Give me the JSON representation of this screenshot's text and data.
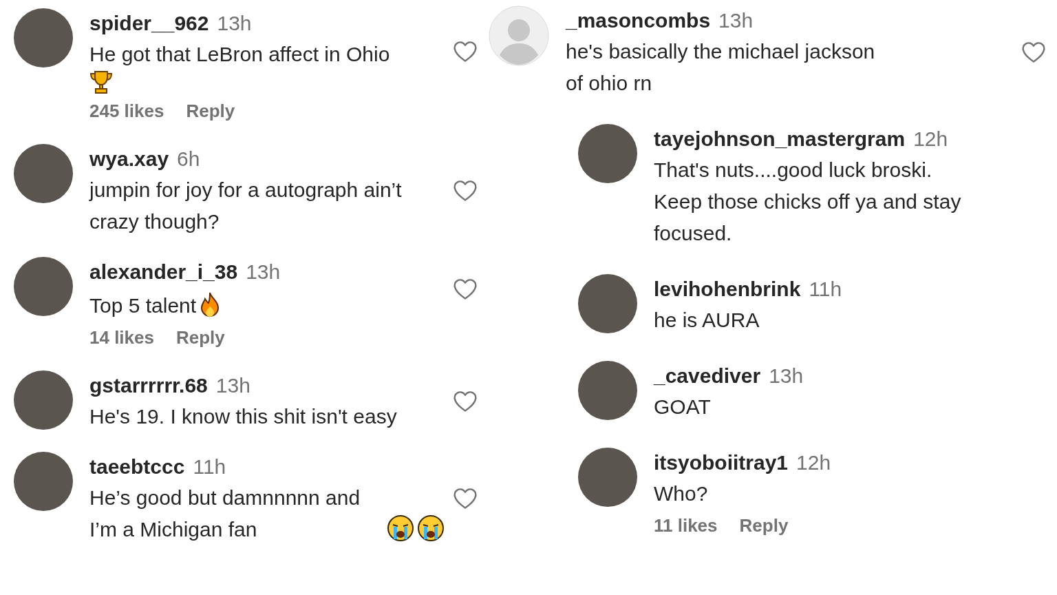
{
  "columns": [
    {
      "comments": [
        {
          "username": "spider__962",
          "time": "13h",
          "text": "He got that LeBron affect in Ohio",
          "emoji_line": [
            {
              "kind": "trophy"
            }
          ],
          "likes": "245 likes",
          "reply": "Reply",
          "liked": false,
          "kind": "photo"
        },
        {
          "username": "wya.xay",
          "time": "6h",
          "text": "jumpin for joy for a autograph ain’t crazy though?",
          "liked": false,
          "kind": "photo"
        },
        {
          "username": "alexander_i_38",
          "time": "13h",
          "text": "Top 5 talent",
          "emojis": [
            {
              "kind": "fire"
            }
          ],
          "likes": "14 likes",
          "reply": "Reply",
          "liked": false,
          "kind": "photo"
        },
        {
          "username": "gstarrrrrr.68",
          "time": "13h",
          "text": "He's 19. I know this shit isn't easy",
          "liked": false,
          "kind": "photo"
        },
        {
          "username": "taeebtccc",
          "time": "11h",
          "text": "He’s good but damnnnnn and I’m a Michigan fan",
          "emojis": [
            {
              "kind": "crying"
            },
            {
              "kind": "crying"
            }
          ],
          "liked": false,
          "kind": "photo"
        }
      ]
    },
    {
      "comments": [
        {
          "username": "_masoncombs",
          "time": "13h",
          "text": "he's basically the michael jackson of ohio rn",
          "liked": false,
          "kind": "default"
        },
        {
          "username": "tayejohnson_mastergram",
          "time": "12h",
          "text": "That's nuts....good luck broski. Keep those chicks off ya and stay focused.",
          "kind": "photo"
        },
        {
          "username": "levihohenbrink",
          "time": "11h",
          "text": "he is AURA",
          "kind": "photo"
        },
        {
          "username": "_cavediver",
          "time": "13h",
          "text": "GOAT",
          "kind": "photo"
        },
        {
          "username": "itsyoboiitray1",
          "time": "12h",
          "text": "Who?",
          "likes": "11 likes",
          "reply": "Reply",
          "kind": "photo"
        }
      ]
    }
  ]
}
